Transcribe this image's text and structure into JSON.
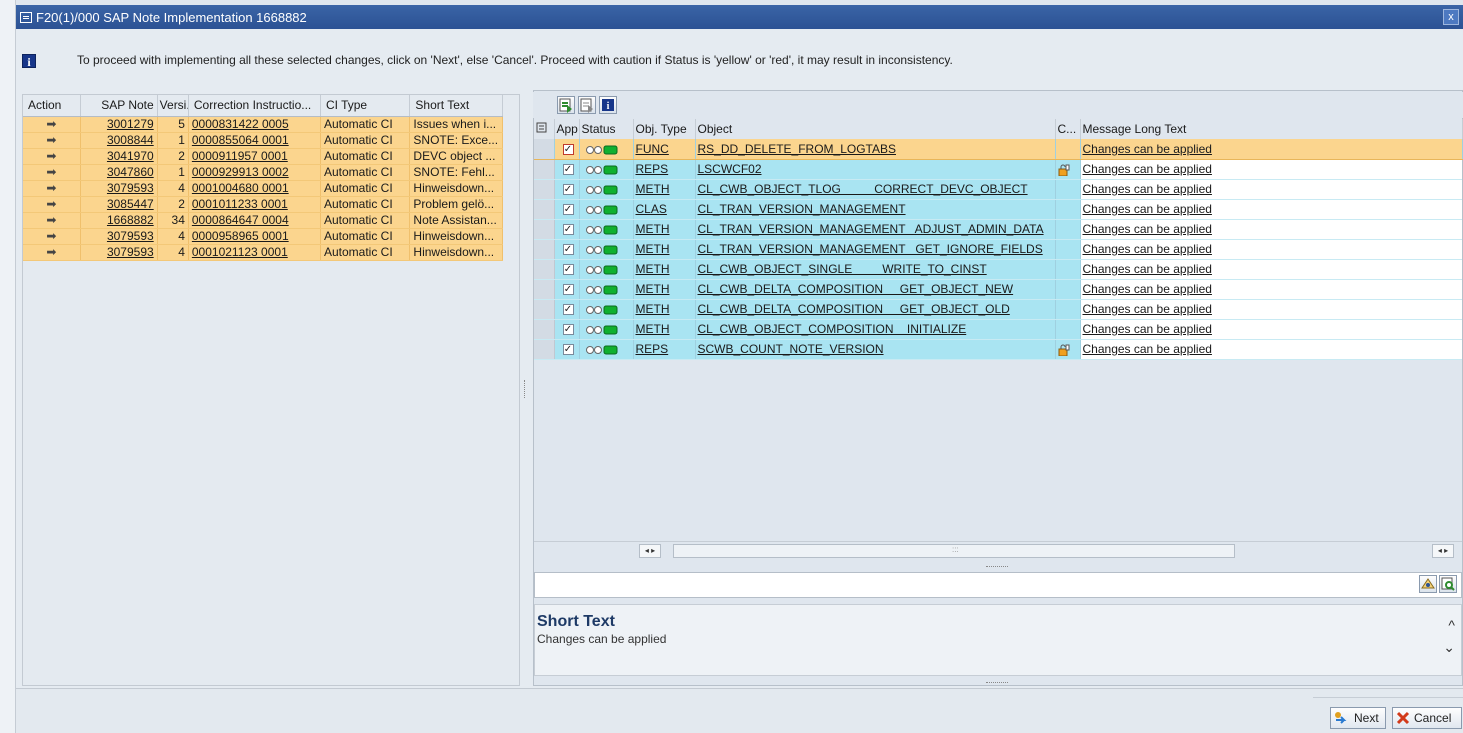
{
  "window": {
    "title": "F20(1)/000 SAP Note Implementation 1668882",
    "close_label": "x"
  },
  "info": {
    "message": "To proceed with implementing all these selected changes, click on 'Next', else 'Cancel'. Proceed with caution if Status is 'yellow' or 'red', it may result in inconsistency."
  },
  "left_table": {
    "headers": [
      "Action",
      "SAP Note",
      "Versi...",
      "Correction Instructio...",
      "CI Type",
      "Short Text"
    ],
    "rows": [
      {
        "action": "➡",
        "note": "3001279",
        "version": "5",
        "ci": "0000831422 0005",
        "type": "Automatic CI",
        "short": "Issues when i..."
      },
      {
        "action": "➡",
        "note": "3008844",
        "version": "1",
        "ci": "0000855064 0001",
        "type": "Automatic CI",
        "short": "SNOTE: Exce..."
      },
      {
        "action": "➡",
        "note": "3041970",
        "version": "2",
        "ci": "0000911957 0001",
        "type": "Automatic CI",
        "short": "DEVC object ..."
      },
      {
        "action": "➡",
        "note": "3047860",
        "version": "1",
        "ci": "0000929913 0002",
        "type": "Automatic CI",
        "short": "SNOTE:  Fehl..."
      },
      {
        "action": "➡",
        "note": "3079593",
        "version": "4",
        "ci": "0001004680 0001",
        "type": "Automatic CI",
        "short": "Hinweisdown..."
      },
      {
        "action": "➡",
        "note": "3085447",
        "version": "2",
        "ci": "0001011233 0001",
        "type": "Automatic CI",
        "short": "Problem gelö..."
      },
      {
        "action": "➡",
        "note": "1668882",
        "version": "34",
        "ci": "0000864647 0004",
        "type": "Automatic CI",
        "short": "Note Assistan..."
      },
      {
        "action": "➡",
        "note": "3079593",
        "version": "4",
        "ci": "0000958965 0001",
        "type": "Automatic CI",
        "short": "Hinweisdown..."
      },
      {
        "action": "➡",
        "note": "3079593",
        "version": "4",
        "ci": "0001021123 0001",
        "type": "Automatic CI",
        "short": "Hinweisdown..."
      }
    ]
  },
  "right_table": {
    "headers": [
      "",
      "App",
      "Status",
      "Obj. Type",
      "Object",
      "C...",
      "Message Long Text"
    ],
    "rows": [
      {
        "checked": "✓",
        "type": "FUNC",
        "object": "RS_DD_DELETE_FROM_LOGTABS",
        "lock": false,
        "message": "Changes can be applied",
        "highlight": true
      },
      {
        "checked": "✓",
        "type": "REPS",
        "object": "LSCWCF02",
        "lock": true,
        "message": "Changes can be applied",
        "highlight": false
      },
      {
        "checked": "✓",
        "type": "METH",
        "object": "CL_CWB_OBJECT_TLOG          CORRECT_DEVC_OBJECT",
        "lock": false,
        "message": "Changes can be applied",
        "highlight": false
      },
      {
        "checked": "✓",
        "type": "CLAS",
        "object": "CL_TRAN_VERSION_MANAGEMENT",
        "lock": false,
        "message": "Changes can be applied",
        "highlight": false
      },
      {
        "checked": "✓",
        "type": "METH",
        "object": "CL_TRAN_VERSION_MANAGEMENT   ADJUST_ADMIN_DATA",
        "lock": false,
        "message": "Changes can be applied",
        "highlight": false
      },
      {
        "checked": "✓",
        "type": "METH",
        "object": "CL_TRAN_VERSION_MANAGEMENT   GET_IGNORE_FIELDS",
        "lock": false,
        "message": "Changes can be applied",
        "highlight": false
      },
      {
        "checked": "✓",
        "type": "METH",
        "object": "CL_CWB_OBJECT_SINGLE         WRITE_TO_CINST",
        "lock": false,
        "message": "Changes can be applied",
        "highlight": false
      },
      {
        "checked": "✓",
        "type": "METH",
        "object": "CL_CWB_DELTA_COMPOSITION     GET_OBJECT_NEW",
        "lock": false,
        "message": "Changes can be applied",
        "highlight": false
      },
      {
        "checked": "✓",
        "type": "METH",
        "object": "CL_CWB_DELTA_COMPOSITION     GET_OBJECT_OLD",
        "lock": false,
        "message": "Changes can be applied",
        "highlight": false
      },
      {
        "checked": "✓",
        "type": "METH",
        "object": "CL_CWB_OBJECT_COMPOSITION    INITIALIZE",
        "lock": false,
        "message": "Changes can be applied",
        "highlight": false
      },
      {
        "checked": "✓",
        "type": "REPS",
        "object": "SCWB_COUNT_NOTE_VERSION",
        "lock": true,
        "message": "Changes can be applied",
        "highlight": false
      }
    ]
  },
  "hscroll": {
    "left": "◂ ▸",
    "right": "◂ ▸",
    "grip": ":::"
  },
  "short_text": {
    "heading": "Short Text",
    "text": "Changes can be applied",
    "up": "^",
    "down": "⌄"
  },
  "footer": {
    "next_label": "Next",
    "cancel_label": "Cancel"
  },
  "colors": {
    "title_bar": "#2c5294",
    "left_row": "#fbd58e",
    "right_row": "#a9e4f2",
    "highlight_row": "#fbd58e"
  }
}
